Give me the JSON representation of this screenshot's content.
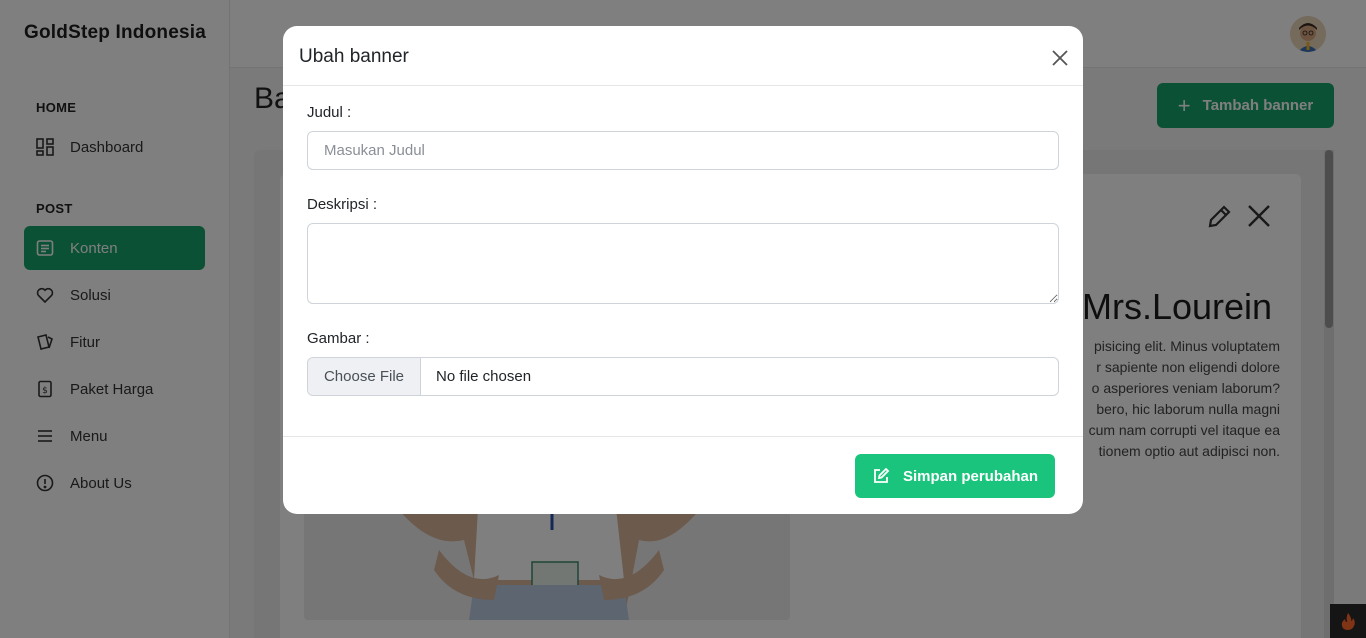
{
  "sidebar": {
    "brand": "GoldStep Indonesia",
    "sections": [
      {
        "label": "HOME"
      },
      {
        "label": "POST"
      }
    ],
    "items": [
      {
        "label": "Dashboard",
        "icon": "dashboard-icon"
      },
      {
        "label": "Konten",
        "icon": "document-list-icon",
        "active": true
      },
      {
        "label": "Solusi",
        "icon": "heart-icon"
      },
      {
        "label": "Fitur",
        "icon": "cards-icon"
      },
      {
        "label": "Paket Harga",
        "icon": "price-tag-icon"
      },
      {
        "label": "Menu",
        "icon": "hamburger-menu-icon"
      },
      {
        "label": "About Us",
        "icon": "info-circle-icon"
      }
    ]
  },
  "header": {
    "avatar": "user-avatar"
  },
  "page": {
    "title_partial": "Ba",
    "add_button_label": "Tambah banner"
  },
  "banner_card": {
    "heading_partial": "Mrs.Lourein",
    "text_lines": [
      "pisicing elit. Minus voluptatem",
      "r sapiente non eligendi dolore",
      "o asperiores veniam laborum?",
      "bero, hic laborum nulla magni",
      "cum nam corrupti vel itaque ea",
      "tionem optio aut adipisci non."
    ]
  },
  "modal": {
    "title": "Ubah banner",
    "fields": {
      "judul_label": "Judul :",
      "judul_placeholder": "Masukan Judul",
      "judul_value": "",
      "deskripsi_label": "Deskripsi :",
      "deskripsi_value": "",
      "gambar_label": "Gambar :",
      "file_button": "Choose File",
      "file_status": "No file chosen"
    },
    "save_label": "Simpan perubahan"
  },
  "colors": {
    "primary": "#16a36b",
    "save_button": "#1bc47d"
  }
}
